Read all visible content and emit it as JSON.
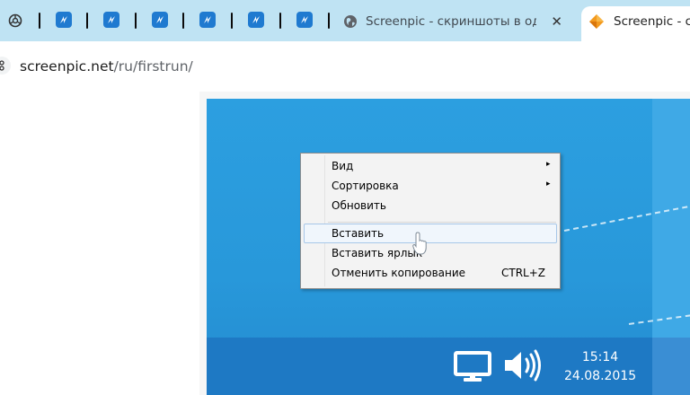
{
  "tabs": {
    "inactive": {
      "title": "Screenpic - скриншоты в один",
      "close": "✕"
    },
    "active": {
      "title": "Screenpic - ск"
    }
  },
  "address": {
    "domain": "screenpic.net",
    "path": "/ru/firstrun/"
  },
  "context_menu": {
    "items": [
      {
        "label": "Вид",
        "submenu": "▸"
      },
      {
        "label": "Сортировка",
        "submenu": "▸"
      },
      {
        "label": "Обновить"
      },
      {
        "label": "Вставить"
      },
      {
        "label": "Вставить ярлык"
      },
      {
        "label": "Отменить копирование",
        "shortcut": "CTRL+Z"
      }
    ]
  },
  "taskbar": {
    "time": "15:14",
    "date": "24.08.2015"
  },
  "colors": {
    "tab_strip": "#bfe3f3",
    "desktop": "#2898da",
    "taskbar": "#1e79c4",
    "pinned_tab": "#1f7ad0"
  },
  "icons": {
    "pinned": "bitrix-icon",
    "first_pinned": "chatgpt-icon",
    "inactive_favicon": "globe-icon",
    "active_favicon": "screenpic-logo-icon",
    "site_info": "tune-icon",
    "tray": [
      "monitor-icon",
      "speaker-icon"
    ]
  }
}
